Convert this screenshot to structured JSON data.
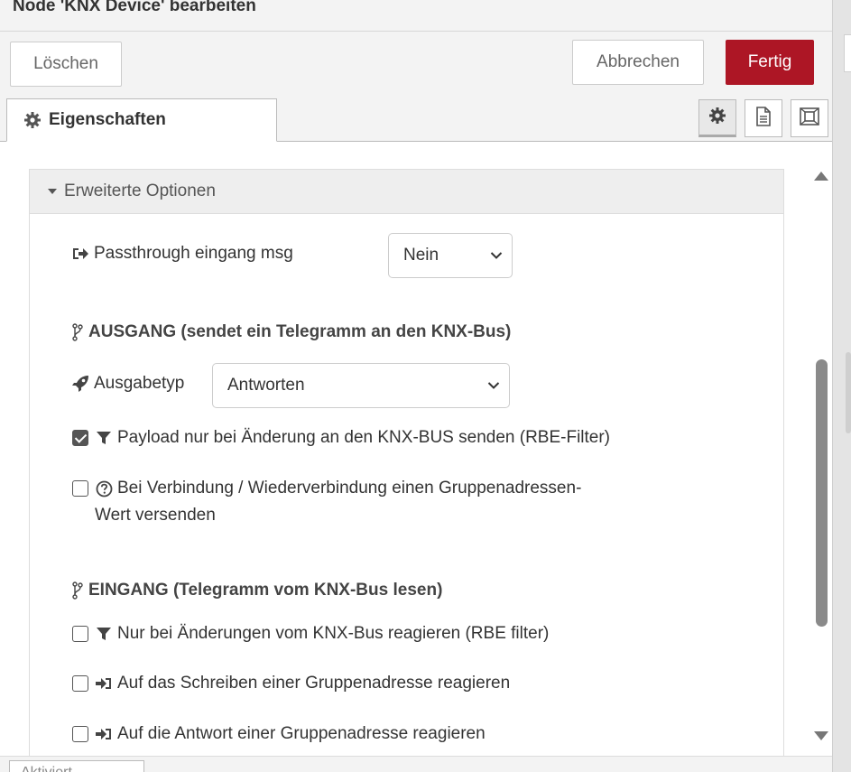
{
  "header": {
    "title": "Node 'KNX Device' bearbeiten"
  },
  "buttons": {
    "delete": "Löschen",
    "cancel": "Abbrechen",
    "done": "Fertig"
  },
  "tabs": {
    "properties": "Eigenschaften"
  },
  "tab_icons": [
    "gear-icon",
    "document-icon",
    "frame-icon"
  ],
  "advanced": {
    "label": "Erweiterte Optionen",
    "passthrough_label": "Passthrough eingang msg",
    "passthrough_value": "Nein"
  },
  "output": {
    "section": "AUSGANG (sendet ein Telegramm an den KNX-Bus)",
    "type_label": "Ausgabetyp",
    "type_value": "Antworten",
    "rbe_label": "Payload nur bei Änderung an den KNX-BUS senden (RBE-Filter)",
    "rbe_checked": true,
    "reconnect_label_line1": "Bei Verbindung / Wiederverbindung einen Gruppenadressen-",
    "reconnect_label_line2": "Wert versenden",
    "reconnect_checked": false
  },
  "input": {
    "section": "EINGANG (Telegramm vom KNX-Bus lesen)",
    "rbe_label": "Nur bei Änderungen vom KNX-Bus reagieren (RBE filter)",
    "write_label": "Auf das Schreiben einer Gruppenadresse reagieren",
    "response_label": "Auf die Antwort einer Gruppenadresse reagieren"
  },
  "footer": {
    "tab_label": "Aktiviert"
  },
  "colors": {
    "primary": "#ad1625",
    "text": "#333333",
    "panel_bg": "#eeeeee"
  }
}
